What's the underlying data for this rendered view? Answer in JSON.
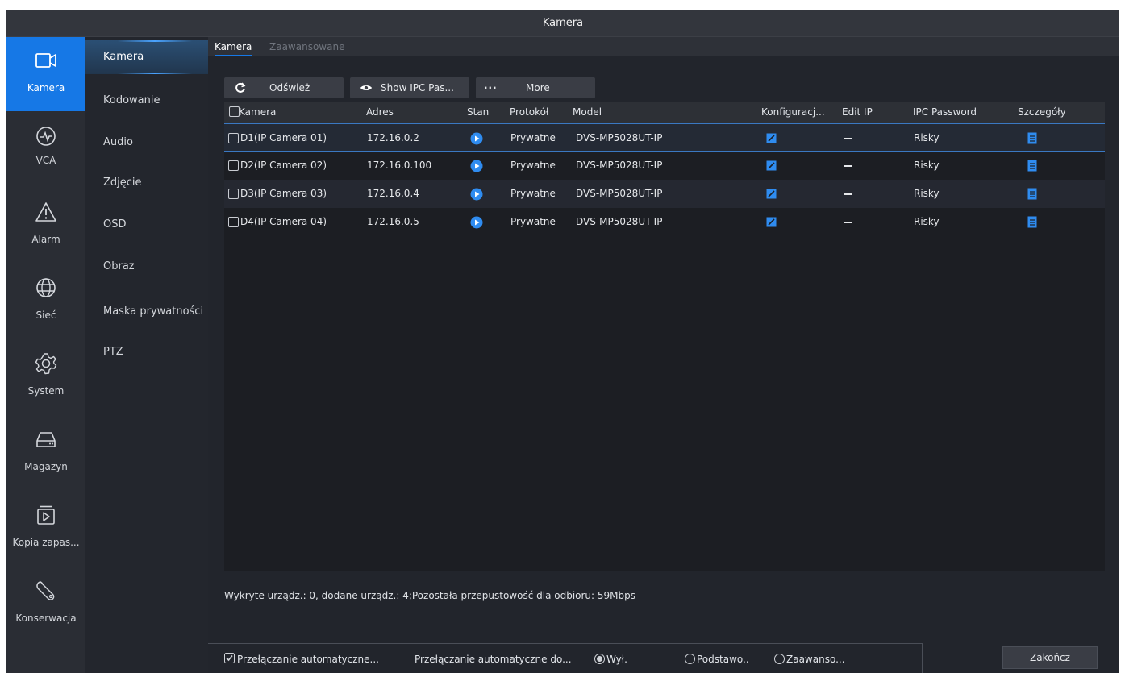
{
  "window": {
    "title": "Kamera"
  },
  "rail": {
    "items": [
      {
        "label": "Kamera",
        "icon": "camera-icon",
        "active": true
      },
      {
        "label": "VCA",
        "icon": "vca-icon"
      },
      {
        "label": "Alarm",
        "icon": "alarm-icon"
      },
      {
        "label": "Sieć",
        "icon": "network-icon"
      },
      {
        "label": "System",
        "icon": "gear-icon"
      },
      {
        "label": "Magazyn",
        "icon": "storage-icon"
      },
      {
        "label": "Kopia zapas...",
        "icon": "backup-icon"
      },
      {
        "label": "Konserwacja",
        "icon": "wrench-icon"
      }
    ]
  },
  "submenu": {
    "items": [
      {
        "label": "Kamera",
        "active": true
      },
      {
        "label": "Kodowanie"
      },
      {
        "label": "Audio"
      },
      {
        "label": "Zdjęcie"
      },
      {
        "label": "OSD"
      },
      {
        "label": "Obraz"
      },
      {
        "label": "Maska prywatności"
      },
      {
        "label": "PTZ"
      }
    ]
  },
  "tabs": [
    {
      "label": "Kamera",
      "active": true
    },
    {
      "label": "Zaawansowane"
    }
  ],
  "toolbar": {
    "refresh_label": "Odśwież",
    "show_password_label": "Show IPC Pas...",
    "more_dots": "···",
    "more_label": "More"
  },
  "table": {
    "columns": [
      "Kamera",
      "Adres",
      "Stan",
      "Protokół",
      "Model",
      "Konfiguracj...",
      "Edit IP",
      "IPC Password",
      "Szczegóły"
    ],
    "rows": [
      {
        "camera": "D1(IP Camera 01)",
        "address": "172.16.0.2",
        "protocol": "Prywatne",
        "model": "DVS-MP5028UT-IP",
        "password": "Risky"
      },
      {
        "camera": "D2(IP Camera 02)",
        "address": "172.16.0.100",
        "protocol": "Prywatne",
        "model": "DVS-MP5028UT-IP",
        "password": "Risky"
      },
      {
        "camera": "D3(IP Camera 03)",
        "address": "172.16.0.4",
        "protocol": "Prywatne",
        "model": "DVS-MP5028UT-IP",
        "password": "Risky"
      },
      {
        "camera": "D4(IP Camera 04)",
        "address": "172.16.0.5",
        "protocol": "Prywatne",
        "model": "DVS-MP5028UT-IP",
        "password": "Risky"
      }
    ]
  },
  "status_text": "Wykryte urządz.: 0, dodane urządz.: 4;Pozostała przepustowość dla odbioru: 59Mbps",
  "bottom": {
    "auto_switch_label": "Przełączanie automatyczne...",
    "auto_switch_to_label": "Przełączanie automatyczne do...",
    "radio_off": "Wył.",
    "radio_basic": "Podstawo..",
    "radio_advanced": "Zaawanso...",
    "exit_label": "Zakończ"
  },
  "colors": {
    "accent": "#1678e6",
    "background": "#22252c",
    "icon_blue": "#2f8cf0"
  }
}
